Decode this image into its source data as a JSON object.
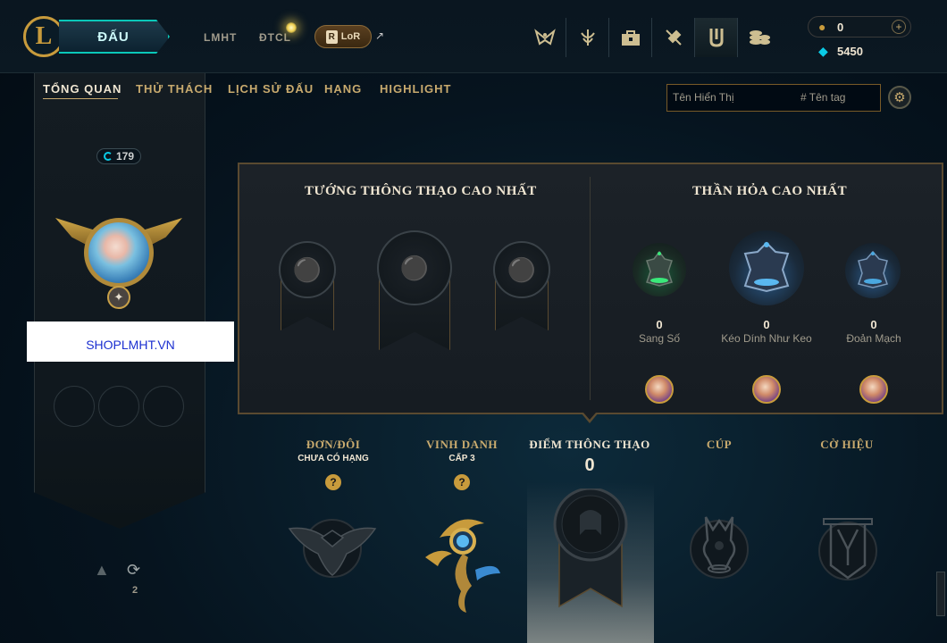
{
  "topbar": {
    "logo_letter": "L",
    "play_label": "ĐẤU",
    "nav": [
      "LMHT",
      "ĐTCL"
    ],
    "lor_label": "LoR",
    "lor_icon_letter": "R",
    "ext_arrow": "↗",
    "icons": [
      "clash-icon",
      "mastery-icon",
      "store-icon",
      "crafting-icon",
      "collection-icon",
      "loot-icon"
    ],
    "rp_value": "0",
    "be_value": "5450",
    "plus_label": "+"
  },
  "subnav": {
    "tabs": [
      "TỔNG QUAN",
      "THỬ THÁCH",
      "LỊCH SỬ ĐẤU",
      "HẠNG",
      "HIGHLIGHT"
    ],
    "active": "TỔNG QUAN"
  },
  "profile": {
    "name_placeholder": "Tên Hiển Thị",
    "tag_placeholder": "# Tên tag",
    "level": "179",
    "watermark": "SHOPLMHT.VN",
    "reroll_count": "2"
  },
  "panel": {
    "mastery_title": "TƯỚNG THÔNG THẠO CAO NHẤT",
    "eternals_title": "THẦN HỎA CAO NHẤT",
    "eternals": [
      {
        "value": "0",
        "label": "Sang Số"
      },
      {
        "value": "0",
        "label": "Kéo Dính Như Keo"
      },
      {
        "value": "0",
        "label": "Đoản Mạch"
      }
    ]
  },
  "categories": {
    "ranked_title": "ĐƠN/ĐÔI",
    "ranked_sub": "CHƯA CÓ HẠNG",
    "honor_title": "VINH DANH",
    "honor_sub": "CẤP 3",
    "mastery_title": "ĐIỂM THÔNG THẠO",
    "mastery_score": "0",
    "cup_title": "CÚP",
    "banner_title": "CỜ HIỆU",
    "question_mark": "?"
  },
  "colors": {
    "gold": "#c8aa6e",
    "teal": "#0ac8b9",
    "blue_essence": "#0acbe6",
    "watermark_text": "#1b2fd0"
  }
}
